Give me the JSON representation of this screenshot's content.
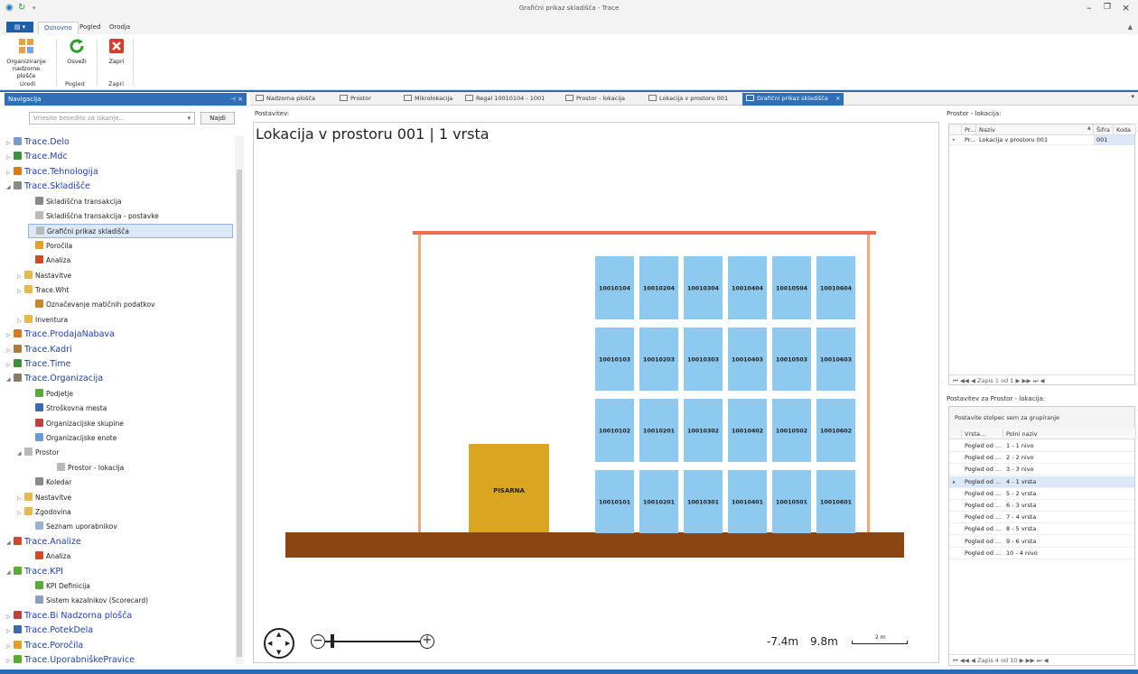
{
  "window": {
    "title": "Grafični prikaz skladišča - Trace"
  },
  "ribbon": {
    "file_label": "",
    "tabs": [
      "Osnovno",
      "Pogled",
      "Orodja"
    ],
    "buttons": {
      "organize": "Organiziranje nadzorne plošče",
      "refresh": "Osveži",
      "close": "Zapri"
    },
    "groups": {
      "uredi": "Uredi",
      "pogled": "Pogled",
      "zapri": "Zapri"
    }
  },
  "nav": {
    "header": "Navigacija",
    "search_placeholder": "Vnesite besedilo za iskanje...",
    "find_button": "Najdi",
    "items": [
      {
        "label": "Trace.Delo",
        "level": 0,
        "top": true,
        "color": "#7a9cc6"
      },
      {
        "label": "Trace.Mdc",
        "level": 0,
        "top": true,
        "color": "#3f8f3f"
      },
      {
        "label": "Trace.Tehnologija",
        "level": 0,
        "top": true,
        "color": "#d97a1e"
      },
      {
        "label": "Trace.Skladišče",
        "level": 0,
        "top": true,
        "color": "#8a8a8a"
      },
      {
        "label": "Skladiščna transakcija",
        "level": 1,
        "color": "#8a8a8a"
      },
      {
        "label": "Skladiščna transakcija - postavke",
        "level": 1,
        "color": "#b9b9b9"
      },
      {
        "label": "Grafični prikaz skladišča",
        "level": 1,
        "selected": true,
        "color": "#b9b9b9"
      },
      {
        "label": "Poročila",
        "level": 1,
        "color": "#e2a02b"
      },
      {
        "label": "Analiza",
        "level": 1,
        "color": "#d04a2a"
      },
      {
        "label": "Nastavitve",
        "level": 1,
        "color": "#e9b84a"
      },
      {
        "label": "Trace.Wht",
        "level": 1,
        "color": "#e9b84a"
      },
      {
        "label": "Označevanje matičnih podatkov",
        "level": 1,
        "color": "#c8862a"
      },
      {
        "label": "Inventura",
        "level": 1,
        "color": "#e9b84a"
      },
      {
        "label": "Trace.ProdajaNabava",
        "level": 0,
        "top": true,
        "color": "#d97a1e"
      },
      {
        "label": "Trace.Kadri",
        "level": 0,
        "top": true,
        "color": "#b07a3a"
      },
      {
        "label": "Trace.Time",
        "level": 0,
        "top": true,
        "color": "#3f8f3f"
      },
      {
        "label": "Trace.Organizacija",
        "level": 0,
        "top": true,
        "color": "#8a7a6a"
      },
      {
        "label": "Podjetje",
        "level": 1,
        "color": "#5aaa3a"
      },
      {
        "label": "Stroškovna mesta",
        "level": 1,
        "color": "#3a6ab0"
      },
      {
        "label": "Organizacijske skupine",
        "level": 1,
        "color": "#c04040"
      },
      {
        "label": "Organizacijske enote",
        "level": 1,
        "color": "#6a9ad0"
      },
      {
        "label": "Prostor",
        "level": 1,
        "color": "#b9b9b9"
      },
      {
        "label": "Prostor - lokacija",
        "level": 2,
        "color": "#b9b9b9"
      },
      {
        "label": "Koledar",
        "level": 1,
        "color": "#8a8a8a"
      },
      {
        "label": "Nastavitve",
        "level": 1,
        "color": "#e9b84a"
      },
      {
        "label": "Zgodovina",
        "level": 1,
        "color": "#e9b84a"
      },
      {
        "label": "Seznam uporabnikov",
        "level": 1,
        "color": "#9ab0d0"
      },
      {
        "label": "Trace.Analize",
        "level": 0,
        "top": true,
        "color": "#d04a2a"
      },
      {
        "label": "Analiza",
        "level": 1,
        "color": "#d04a2a"
      },
      {
        "label": "Trace.KPI",
        "level": 0,
        "top": true,
        "color": "#5aaa3a"
      },
      {
        "label": "KPI Definicija",
        "level": 1,
        "color": "#5aaa3a"
      },
      {
        "label": "Sistem kazalnikov  (Scorecard)",
        "level": 1,
        "color": "#8aa0c0"
      },
      {
        "label": "Trace.Bi Nadzorna plošča",
        "level": 0,
        "top": true,
        "color": "#c04040"
      },
      {
        "label": "Trace.PotekDela",
        "level": 0,
        "top": true,
        "color": "#3a6ab0"
      },
      {
        "label": "Trace.Poročila",
        "level": 0,
        "top": true,
        "color": "#e2a02b"
      },
      {
        "label": "Trace.UporabniškePravice",
        "level": 0,
        "top": true,
        "color": "#5aaa3a"
      }
    ]
  },
  "doc_tabs": [
    {
      "label": "Nadzorna plošča"
    },
    {
      "label": "Prostor"
    },
    {
      "label": "Mikrolokacija"
    },
    {
      "label": "Regal 10010104 - 1001"
    },
    {
      "label": "Prostor - lokacija"
    },
    {
      "label": "Lokacija v prostoru 001"
    },
    {
      "label": "Grafični prikaz skladišča",
      "active": true
    }
  ],
  "main": {
    "postavitev_label": "Postavitev:",
    "heading": "Lokacija v prostoru 001 | 1 vrsta",
    "office_label": "PISARNA",
    "rack_rows": [
      [
        "10010104",
        "10010204",
        "10010304",
        "10010404",
        "10010504",
        "10010604"
      ],
      [
        "10010103",
        "10010203",
        "10010303",
        "10010403",
        "10010503",
        "10010603"
      ],
      [
        "10010102",
        "10010201",
        "10010302",
        "10010402",
        "10010502",
        "10010602"
      ],
      [
        "10010101",
        "10010201",
        "10010301",
        "10010401",
        "10010501",
        "10010601"
      ]
    ],
    "coord_x": "-7.4m",
    "coord_y": "9.8m",
    "scale_label": "2 m",
    "colors": {
      "floor": "#8b4513",
      "frame": "#f4a67c",
      "roof": "#ee6c52",
      "slot": "#8ecaf0",
      "office": "#daa520"
    }
  },
  "right": {
    "panel1_title": "Prostor - lokacija:",
    "grid1_headers": [
      "Pr...",
      "Naziv",
      "Šifra",
      "Koda"
    ],
    "grid1_row": [
      "Pr...",
      "Lokacija v prostoru 001",
      "001",
      ""
    ],
    "grid1_pager": "Zapis 1 od 1",
    "panel2_title": "Postavitev za Prostor - lokacija:",
    "group_hint": "Postavite stolpec sem za grupiranje",
    "grid2_headers": [
      "Vrsta...",
      "Polni naziv"
    ],
    "grid2_rows": [
      [
        "Pogled od ...",
        "1 - 1 nivo"
      ],
      [
        "Pogled od ...",
        "2 - 2 nivo"
      ],
      [
        "Pogled od ...",
        "3 - 3 nivo"
      ],
      [
        "Pogled od ...",
        "4 - 1 vrsta"
      ],
      [
        "Pogled od ...",
        "5 - 2 vrsta"
      ],
      [
        "Pogled od ...",
        "6 - 3 vrsta"
      ],
      [
        "Pogled od ...",
        "7 - 4 vrsta"
      ],
      [
        "Pogled od ...",
        "8 - 5 vrsta"
      ],
      [
        "Pogled od ...",
        "9 - 6 vrsta"
      ],
      [
        "Pogled od ...",
        "10 - 4 nivo"
      ]
    ],
    "grid2_selected": 3,
    "grid2_pager": "Zapis 4 od 10"
  }
}
